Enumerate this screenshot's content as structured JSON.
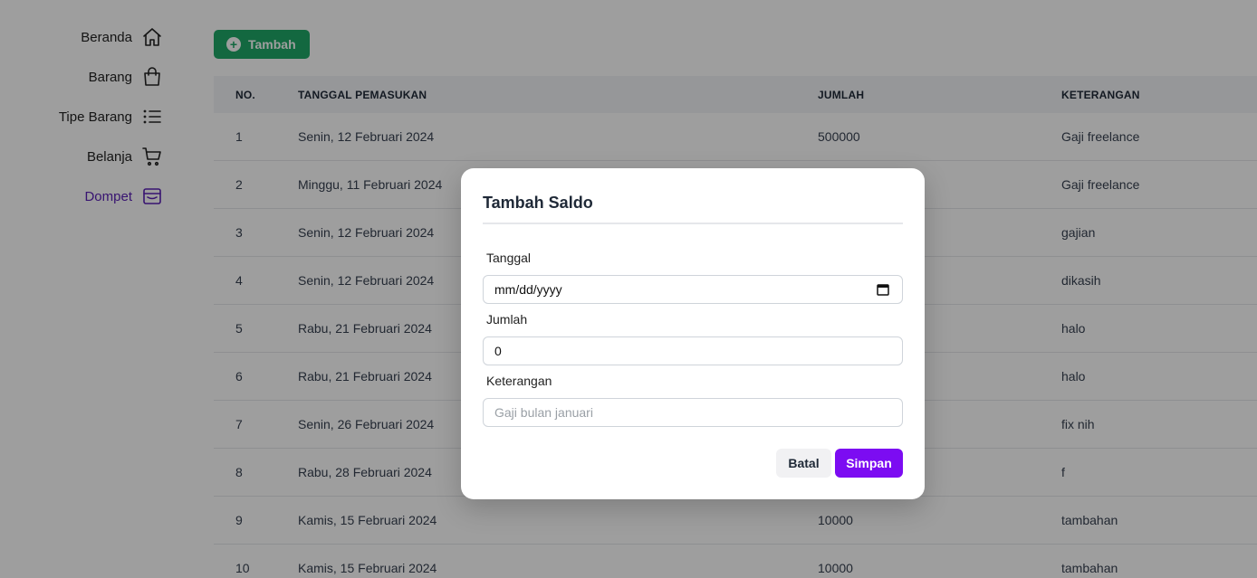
{
  "sidebar": {
    "items": [
      {
        "label": "Beranda",
        "icon": "home-icon"
      },
      {
        "label": "Barang",
        "icon": "shopping-bag-icon"
      },
      {
        "label": "Tipe Barang",
        "icon": "list-icon"
      },
      {
        "label": "Belanja",
        "icon": "cart-icon"
      },
      {
        "label": "Dompet",
        "icon": "wallet-icon",
        "active": true
      }
    ]
  },
  "toolbar": {
    "add_label": "Tambah"
  },
  "table": {
    "headers": [
      "NO.",
      "TANGGAL PEMASUKAN",
      "JUMLAH",
      "KETERANGAN"
    ],
    "rows": [
      {
        "no": "1",
        "date": "Senin, 12 Februari 2024",
        "amount": "500000",
        "note": "Gaji freelance"
      },
      {
        "no": "2",
        "date": "Minggu, 11 Februari 2024",
        "amount": "",
        "note": "Gaji freelance"
      },
      {
        "no": "3",
        "date": "Senin, 12 Februari 2024",
        "amount": "",
        "note": "gajian"
      },
      {
        "no": "4",
        "date": "Senin, 12 Februari 2024",
        "amount": "",
        "note": "dikasih"
      },
      {
        "no": "5",
        "date": "Rabu, 21 Februari 2024",
        "amount": "",
        "note": "halo"
      },
      {
        "no": "6",
        "date": "Rabu, 21 Februari 2024",
        "amount": "",
        "note": "halo"
      },
      {
        "no": "7",
        "date": "Senin, 26 Februari 2024",
        "amount": "",
        "note": "fix nih"
      },
      {
        "no": "8",
        "date": "Rabu, 28 Februari 2024",
        "amount": "",
        "note": "f"
      },
      {
        "no": "9",
        "date": "Kamis, 15 Februari 2024",
        "amount": "10000",
        "note": "tambahan"
      },
      {
        "no": "10",
        "date": "Kamis, 15 Februari 2024",
        "amount": "10000",
        "note": "tambahan"
      }
    ]
  },
  "modal": {
    "title": "Tambah Saldo",
    "date_label": "Tanggal",
    "date_value": "mm/dd/yyyy",
    "amount_label": "Jumlah",
    "amount_value": "0",
    "note_label": "Keterangan",
    "note_placeholder": "Gaji bulan januari",
    "cancel_label": "Batal",
    "save_label": "Simpan"
  },
  "colors": {
    "accent": "#7c0cf2",
    "add_button": "#1fa868",
    "active_nav": "#5b21b6"
  }
}
